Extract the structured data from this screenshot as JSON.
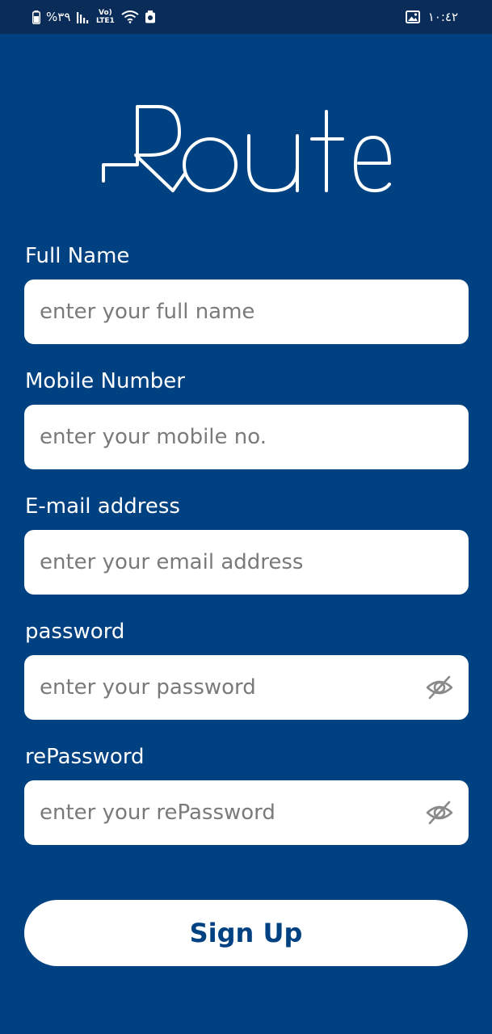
{
  "status_bar": {
    "battery_text": "%٣٩",
    "network_text": "Vo) LTE1",
    "time": "١٠:٤٢",
    "icons": [
      "battery-icon",
      "signal-icon",
      "volte-icon",
      "wifi-icon",
      "notification-icon",
      "gallery-icon"
    ]
  },
  "brand": {
    "logo_text": "Route",
    "background_color": "#004182",
    "status_bar_color": "#0a2c58"
  },
  "form": {
    "fields": [
      {
        "label": "Full Name",
        "placeholder": "enter your full name",
        "value": ""
      },
      {
        "label": "Mobile Number",
        "placeholder": "enter your mobile no.",
        "value": ""
      },
      {
        "label": "E-mail address",
        "placeholder": "enter your email address",
        "value": ""
      },
      {
        "label": "password",
        "placeholder": "enter your password",
        "value": "",
        "visibility_icon": "eye-off-icon"
      },
      {
        "label": "rePassword",
        "placeholder": "enter your rePassword",
        "value": "",
        "visibility_icon": "eye-off-icon"
      }
    ],
    "submit_label": "Sign Up"
  }
}
